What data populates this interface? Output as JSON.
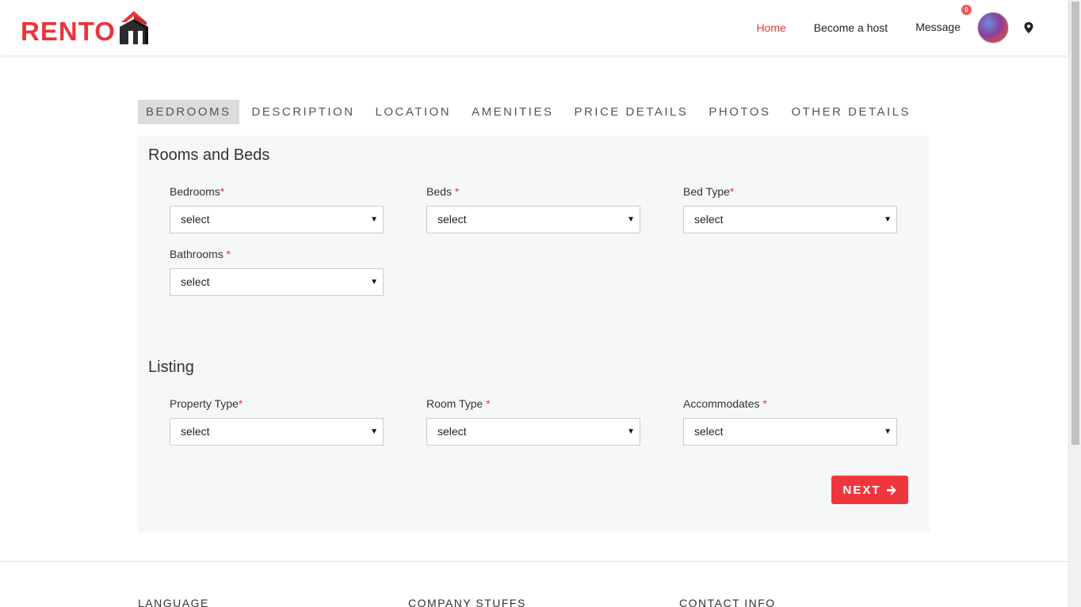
{
  "brand": {
    "name": "RENTO",
    "accent_color": "#e8363c"
  },
  "nav": {
    "home": "Home",
    "become_host": "Become a host",
    "message": "Message",
    "message_count": "0"
  },
  "tabs": [
    {
      "label": "BEDROOMS"
    },
    {
      "label": "DESCRIPTION"
    },
    {
      "label": "LOCATION"
    },
    {
      "label": "AMENITIES"
    },
    {
      "label": "PRICE DETAILS"
    },
    {
      "label": "PHOTOS"
    },
    {
      "label": "OTHER DETAILS"
    }
  ],
  "rooms": {
    "title": "Rooms and Beds",
    "fields": [
      {
        "label": "Bedrooms",
        "value": "select"
      },
      {
        "label": "Beds ",
        "value": "select"
      },
      {
        "label": "Bed Type",
        "value": "select"
      },
      {
        "label": "Bathrooms ",
        "value": "select"
      }
    ]
  },
  "listing": {
    "title": "Listing",
    "fields": [
      {
        "label": "Property Type",
        "value": "select"
      },
      {
        "label": "Room Type ",
        "value": "select"
      },
      {
        "label": "Accommodates ",
        "value": "select"
      }
    ]
  },
  "required_mark": "*",
  "next_label": "NEXT",
  "footer": {
    "language": "LANGUAGE",
    "company": "COMPANY STUFFS",
    "contact": "CONTACT INFO"
  }
}
